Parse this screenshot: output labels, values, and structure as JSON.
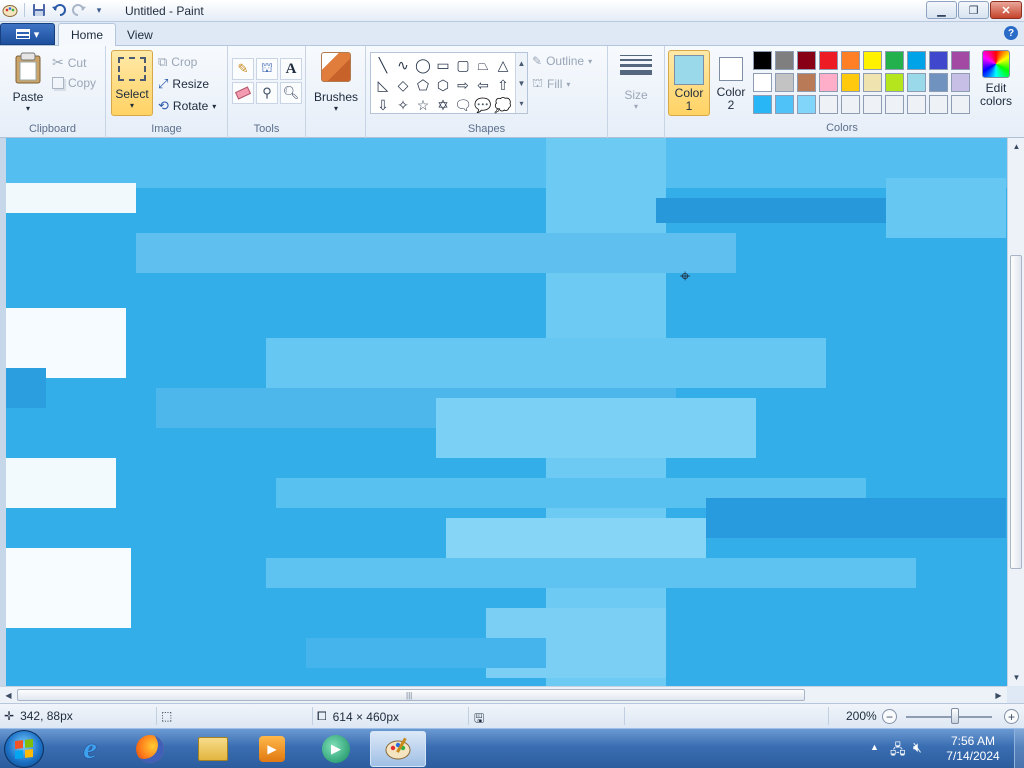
{
  "window": {
    "title": "Untitled - Paint",
    "minimize_icon": "minimize-icon",
    "maximize_icon": "restore-icon",
    "close_icon": "close-icon"
  },
  "quick_access": [
    "save-icon",
    "undo-icon",
    "redo-icon",
    "customize-dropdown-icon"
  ],
  "tabs": [
    {
      "label": "Home",
      "active": true
    },
    {
      "label": "View",
      "active": false
    }
  ],
  "ribbon": {
    "clipboard": {
      "group_label": "Clipboard",
      "paste": "Paste",
      "cut": "Cut",
      "copy": "Copy"
    },
    "image": {
      "group_label": "Image",
      "select": "Select",
      "crop": "Crop",
      "resize": "Resize",
      "rotate": "Rotate"
    },
    "tools": {
      "group_label": "Tools",
      "items": [
        "pencil-icon",
        "fill-bucket-icon",
        "text-icon",
        "eraser-icon",
        "color-picker-icon",
        "magnifier-icon"
      ]
    },
    "brushes": {
      "label": "Brushes"
    },
    "shapes": {
      "group_label": "Shapes",
      "outline": "Outline",
      "fill": "Fill",
      "items": [
        "╲",
        "∿",
        "◯",
        "▭",
        "▢",
        "⏢",
        "△",
        "◺",
        "◇",
        "⬠",
        "⬡",
        "⇨",
        "⇦",
        "⇧",
        "⇩",
        "✧",
        "☆",
        "✡",
        "🗨",
        "💬",
        "💭"
      ]
    },
    "size": {
      "label": "Size"
    },
    "colors": {
      "group_label": "Colors",
      "color1_label": "Color",
      "color1_num": "1",
      "color1_value": "#99d9ea",
      "color2_label": "Color",
      "color2_num": "2",
      "color2_value": "#ffffff",
      "edit_colors_line1": "Edit",
      "edit_colors_line2": "colors",
      "palette": [
        "#000000",
        "#7f7f7f",
        "#880015",
        "#ed1c24",
        "#ff7f27",
        "#fff200",
        "#22b14c",
        "#00a2e8",
        "#3f48cc",
        "#a349a4",
        "#ffffff",
        "#c3c3c3",
        "#b97a57",
        "#ffaec9",
        "#ffc90e",
        "#efe4b0",
        "#b5e61d",
        "#99d9ea",
        "#7092be",
        "#c8bfe7",
        "#29b6f6",
        "#4fc3f7",
        "#81d4fa",
        "#eef2f7",
        "#eef2f7",
        "#eef2f7",
        "#eef2f7",
        "#eef2f7",
        "#eef2f7",
        "#eef2f7"
      ]
    }
  },
  "status": {
    "cursor_pos": "342, 88px",
    "selection_size": "",
    "image_size": "614 × 460px",
    "zoom": "200%"
  },
  "taskbar": {
    "apps": [
      "internet-explorer-icon",
      "firefox-icon",
      "file-explorer-icon",
      "media-player-icon",
      "app-icon",
      "paint-icon"
    ],
    "time": "7:56 AM",
    "date": "7/14/2024"
  }
}
